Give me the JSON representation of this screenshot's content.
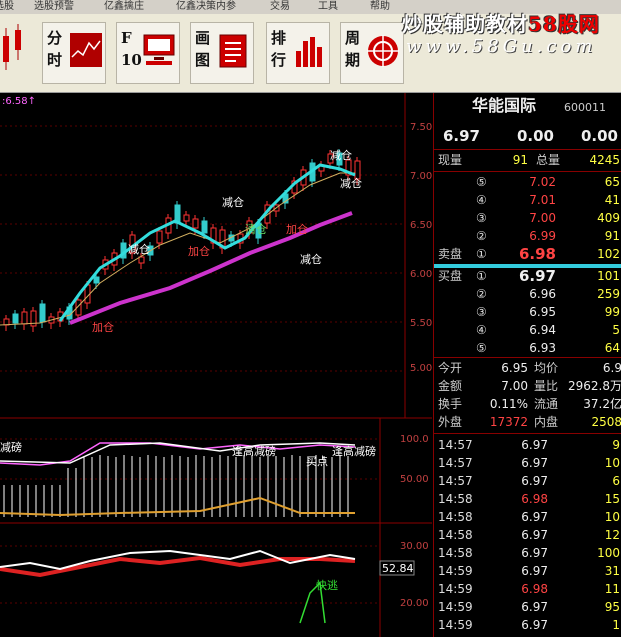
{
  "menu": [
    "选股",
    "选股预警",
    "亿鑫擒庄",
    "亿鑫决策内参",
    "交易",
    "工具",
    "帮助"
  ],
  "toolbar": {
    "buttons": [
      {
        "l1": "分",
        "l2": "时"
      },
      {
        "l1": "F",
        "l2": "10"
      },
      {
        "l1": "画",
        "l2": "图"
      },
      {
        "l1": "排",
        "l2": "行"
      },
      {
        "l1": "周",
        "l2": "期"
      }
    ]
  },
  "watermark": {
    "title_a": "炒股辅助教材",
    "title_b": "58股网",
    "url": "www.58Gu.com"
  },
  "chart": {
    "price_label": ":6.58↑",
    "price_ticks": [
      "7.50",
      "7.00",
      "6.50",
      "6.00",
      "5.50",
      "5.00"
    ],
    "annotations": [
      "减仓",
      "减仓",
      "加仓",
      "减仓",
      "减仓",
      "加仓",
      "清仓",
      "加仓",
      "减仓"
    ],
    "osc1_ticks": [
      "100.0",
      "50.00"
    ],
    "osc1_labels": [
      "减磅",
      "逢高减磅",
      "逢高减磅",
      "买点"
    ],
    "osc2_ticks": [
      "30.00",
      "20.00",
      "10.00"
    ],
    "osc2_value": "52.84",
    "osc2_label": "快逃"
  },
  "quote": {
    "name": "华能国际",
    "code": "600011",
    "last": "6.97",
    "chg": "0.00",
    "chg_pct": "0.00",
    "cur_vol_label": "现量",
    "cur_vol": "91",
    "total_vol_label": "总量",
    "total_vol": "4245",
    "sell_label": "卖盘",
    "buy_label": "买盘",
    "sells": [
      {
        "n": "⑤",
        "p": "7.02",
        "v": "65"
      },
      {
        "n": "④",
        "p": "7.01",
        "v": "41"
      },
      {
        "n": "③",
        "p": "7.00",
        "v": "409"
      },
      {
        "n": "②",
        "p": "6.99",
        "v": "91"
      },
      {
        "n": "①",
        "p": "6.98",
        "v": "102"
      }
    ],
    "buys": [
      {
        "n": "①",
        "p": "6.97",
        "v": "101"
      },
      {
        "n": "②",
        "p": "6.96",
        "v": "259"
      },
      {
        "n": "③",
        "p": "6.95",
        "v": "99"
      },
      {
        "n": "④",
        "p": "6.94",
        "v": "5"
      },
      {
        "n": "⑤",
        "p": "6.93",
        "v": "64"
      }
    ],
    "stats": [
      {
        "a": "今开",
        "av": "6.95",
        "b": "均价",
        "bv": "6.9"
      },
      {
        "a": "金额",
        "av": "7.00",
        "b": "量比",
        "bv": "2962.8万"
      },
      {
        "a": "换手",
        "av": "0.11%",
        "b": "流通",
        "bv": "37.2亿"
      },
      {
        "a": "外盘",
        "av": "17372",
        "b": "内盘",
        "bv": "2508"
      }
    ],
    "ticks": [
      {
        "t": "14:57",
        "p": "6.97",
        "v": "9"
      },
      {
        "t": "14:57",
        "p": "6.97",
        "v": "10"
      },
      {
        "t": "14:57",
        "p": "6.97",
        "v": "6"
      },
      {
        "t": "14:58",
        "p": "6.98",
        "v": "15"
      },
      {
        "t": "14:58",
        "p": "6.97",
        "v": "10"
      },
      {
        "t": "14:58",
        "p": "6.97",
        "v": "12"
      },
      {
        "t": "14:58",
        "p": "6.97",
        "v": "100"
      },
      {
        "t": "14:59",
        "p": "6.97",
        "v": "31"
      },
      {
        "t": "14:59",
        "p": "6.98",
        "v": "11"
      },
      {
        "t": "14:59",
        "p": "6.97",
        "v": "95"
      },
      {
        "t": "14:59",
        "p": "6.97",
        "v": "1"
      }
    ]
  }
}
